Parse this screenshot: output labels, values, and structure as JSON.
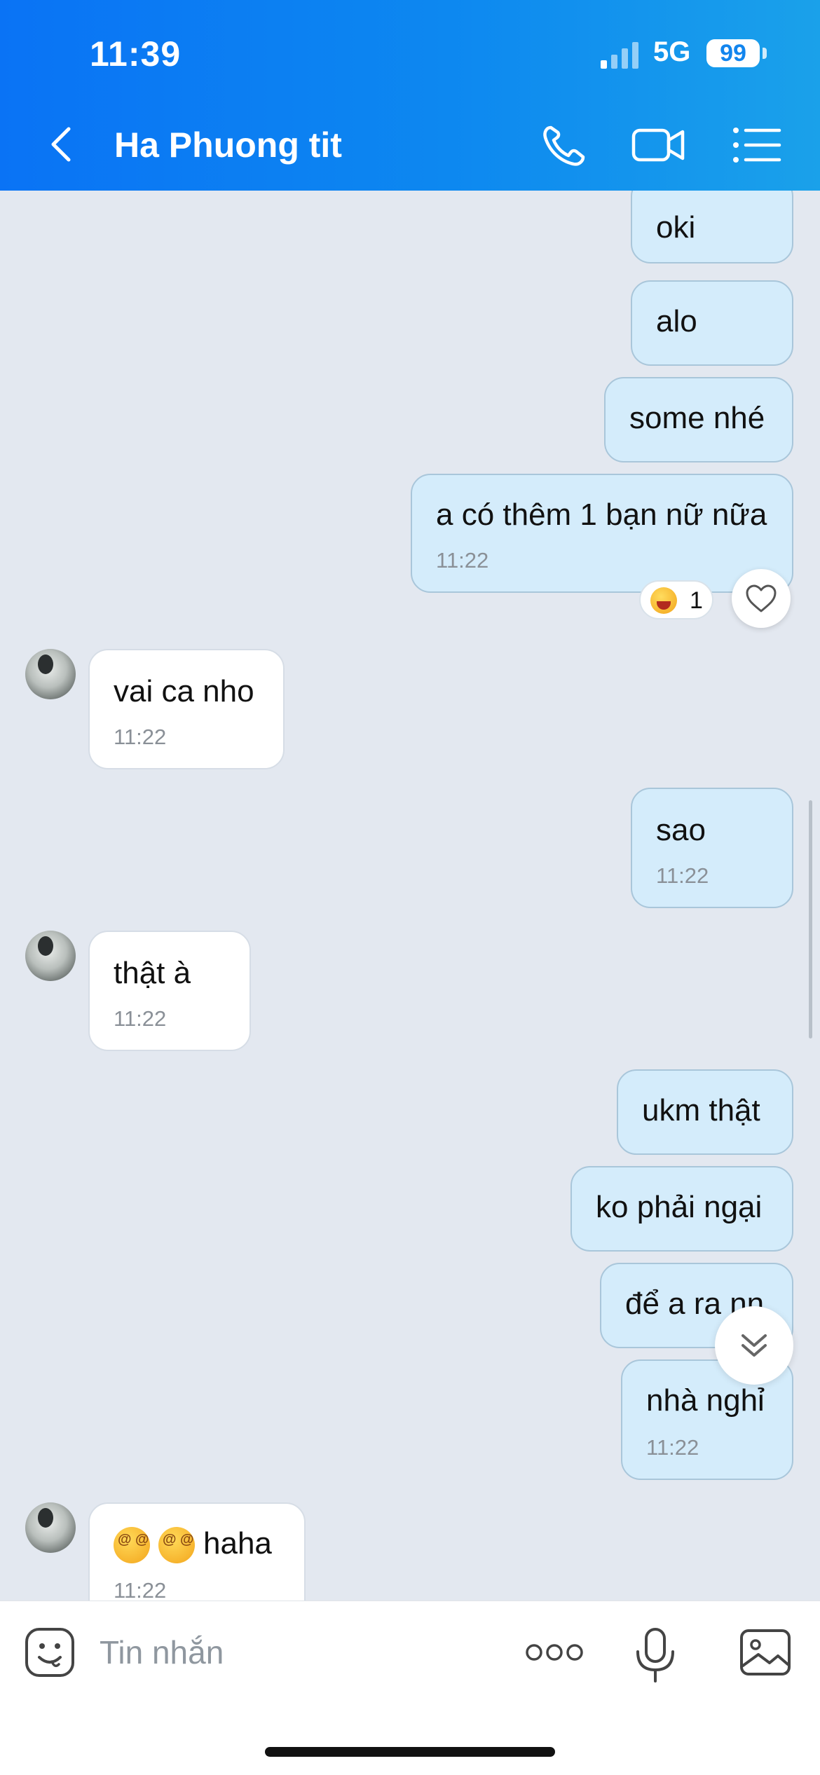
{
  "status": {
    "time": "11:39",
    "network": "5G",
    "battery": "99"
  },
  "header": {
    "contact_name": "Ha Phuong tit"
  },
  "messages": [
    {
      "dir": "out",
      "text": "oki"
    },
    {
      "dir": "out",
      "text": "alo"
    },
    {
      "dir": "out",
      "text": "some nhé"
    },
    {
      "dir": "out",
      "text": "a có thêm 1 bạn nữ nữa",
      "time": "11:22"
    },
    {
      "dir": "in",
      "text": "vai ca nho",
      "time": "11:22"
    },
    {
      "dir": "out",
      "text": "sao",
      "time": "11:22"
    },
    {
      "dir": "in",
      "text": "thật à",
      "time": "11:22"
    },
    {
      "dir": "out",
      "text": "ukm thật"
    },
    {
      "dir": "out",
      "text": "ko phải ngại"
    },
    {
      "dir": "out",
      "text": "để a ra nn"
    },
    {
      "dir": "out",
      "text": "nhà nghỉ",
      "time": "11:22"
    },
    {
      "dir": "in",
      "text": "haha",
      "time": "11:22"
    }
  ],
  "reaction": {
    "count": "1",
    "emoji": "laughing-emoji"
  },
  "input": {
    "placeholder": "Tin nhắn"
  },
  "icons": {
    "back": "chevron-left-icon",
    "call": "phone-icon",
    "video": "video-camera-icon",
    "menu": "list-icon",
    "sticker": "sticker-face-icon",
    "more": "more-dots-icon",
    "mic": "microphone-icon",
    "gallery": "image-icon",
    "like": "heart-icon",
    "scroll_down": "double-chevron-down-icon"
  },
  "colors": {
    "header": "#0a73f5",
    "outgoing_bubble": "#d4ecfb",
    "incoming_bubble": "#ffffff",
    "chat_bg": "#e3e8f0"
  }
}
